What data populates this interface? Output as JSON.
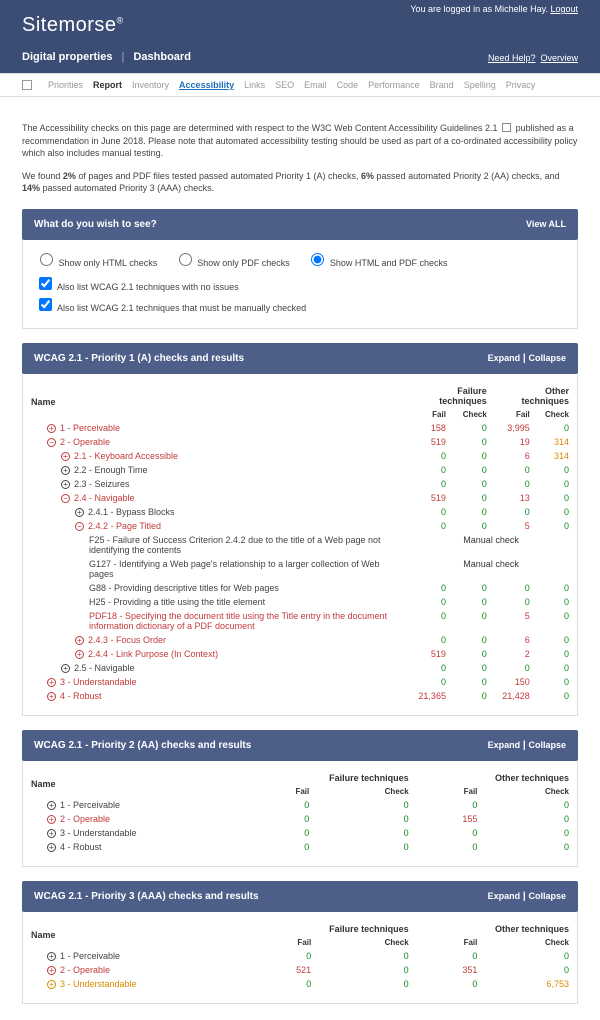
{
  "header": {
    "brand": "Sitemorse",
    "login_prefix": "You are logged in as ",
    "username": "Michelle Hay",
    "logout": "Logout",
    "crumb1": "Digital properties",
    "crumb2": "Dashboard",
    "help": "Need Help?",
    "overview": "Overview"
  },
  "tabs": [
    "Priorities",
    "Report",
    "Inventory",
    "Accessibility",
    "Links",
    "SEO",
    "Email",
    "Code",
    "Performance",
    "Brand",
    "Spelling",
    "Privacy"
  ],
  "intro1a": "The Accessibility checks on this page are determined with respect to the W3C Web Content Accessibility Guidelines 2.1 ",
  "intro1b": " published as a recommendation in June 2018. Please note that automated accessibility testing should be used as part of a co-ordinated accessibility policy which also includes manual testing.",
  "intro2a": "We found ",
  "intro2b": " of pages and PDF files tested passed automated Priority 1 (A) checks, ",
  "intro2c": " passed automated Priority 2 (AA) checks, and ",
  "intro2d": " passed automated Priority 3 (AAA) checks.",
  "pct": {
    "a": "2%",
    "aa": "6%",
    "aaa": "14%"
  },
  "filter": {
    "title": "What do you wish to see?",
    "viewall": "View ALL",
    "opt_html": "Show only HTML checks",
    "opt_pdf": "Show only PDF checks",
    "opt_both": "Show HTML and PDF checks",
    "chk1": "Also list WCAG 2.1 techniques with no issues",
    "chk2": "Also list WCAG 2.1 techniques that must be manually checked"
  },
  "cols": {
    "name": "Name",
    "failgrp": "Failure techniques",
    "othgrp": "Other techniques",
    "fail": "Fail",
    "check": "Check"
  },
  "expand": "Expand",
  "collapse": "Collapse",
  "sections": {
    "a": {
      "title": "WCAG 2.1 - Priority 1 (A) checks and results",
      "rows": [
        {
          "lvl": 0,
          "cls": "red",
          "ico": "+",
          "name": "1 - Perceivable",
          "f": "158",
          "c": "0",
          "of": "3,995",
          "oc": "0"
        },
        {
          "lvl": 0,
          "cls": "red",
          "ico": "−",
          "name": "2 - Operable",
          "f": "519",
          "c": "0",
          "of": "19",
          "oc": "314"
        },
        {
          "lvl": 1,
          "cls": "red",
          "ico": "+",
          "name": "2.1 - Keyboard Accessible",
          "f": "0",
          "c": "0",
          "of": "6",
          "oc": "314"
        },
        {
          "lvl": 1,
          "cls": "",
          "ico": "+",
          "name": "2.2 - Enough Time",
          "f": "0",
          "c": "0",
          "of": "0",
          "oc": "0"
        },
        {
          "lvl": 1,
          "cls": "",
          "ico": "+",
          "name": "2.3 - Seizures",
          "f": "0",
          "c": "0",
          "of": "0",
          "oc": "0"
        },
        {
          "lvl": 1,
          "cls": "red",
          "ico": "−",
          "name": "2.4 - Navigable",
          "f": "519",
          "c": "0",
          "of": "13",
          "oc": "0"
        },
        {
          "lvl": 2,
          "cls": "",
          "ico": "+",
          "name": "2.4.1 - Bypass Blocks",
          "f": "0",
          "c": "0",
          "of": "0",
          "oc": "0"
        },
        {
          "lvl": 2,
          "cls": "red",
          "ico": "−",
          "name": "2.4.2 - Page Titled",
          "f": "0",
          "c": "0",
          "of": "5",
          "oc": "0"
        },
        {
          "lvl": 3,
          "cls": "",
          "ico": "",
          "name": "F25 - Failure of Success Criterion 2.4.2 due to the title of a Web page not identifying the contents",
          "manual": "Manual check"
        },
        {
          "lvl": 3,
          "cls": "",
          "ico": "",
          "name": "G127 - Identifying a Web page's relationship to a larger collection of Web pages",
          "manual": "Manual check"
        },
        {
          "lvl": 3,
          "cls": "",
          "ico": "",
          "name": "G88 - Providing descriptive titles for Web pages",
          "f": "0",
          "c": "0",
          "of": "0",
          "oc": "0"
        },
        {
          "lvl": 3,
          "cls": "",
          "ico": "",
          "name": "H25 - Providing a title using the title element",
          "f": "0",
          "c": "0",
          "of": "0",
          "oc": "0"
        },
        {
          "lvl": 3,
          "cls": "red",
          "ico": "",
          "name": "PDF18 - Specifying the document title using the Title entry in the document information dictionary of a PDF document",
          "f": "0",
          "c": "0",
          "of": "5",
          "oc": "0"
        },
        {
          "lvl": 2,
          "cls": "red",
          "ico": "+",
          "name": "2.4.3 - Focus Order",
          "f": "0",
          "c": "0",
          "of": "6",
          "oc": "0"
        },
        {
          "lvl": 2,
          "cls": "red",
          "ico": "+",
          "name": "2.4.4 - Link Purpose (In Context)",
          "f": "519",
          "c": "0",
          "of": "2",
          "oc": "0"
        },
        {
          "lvl": 1,
          "cls": "",
          "ico": "+",
          "name": "2.5 - Navigable",
          "f": "0",
          "c": "0",
          "of": "0",
          "oc": "0"
        },
        {
          "lvl": 0,
          "cls": "red",
          "ico": "+",
          "name": "3 - Understandable",
          "f": "0",
          "c": "0",
          "of": "150",
          "oc": "0"
        },
        {
          "lvl": 0,
          "cls": "red",
          "ico": "+",
          "name": "4 - Robust",
          "f": "21,365",
          "c": "0",
          "of": "21,428",
          "oc": "0"
        }
      ]
    },
    "aa": {
      "title": "WCAG 2.1 - Priority 2 (AA) checks and results",
      "rows": [
        {
          "lvl": 0,
          "cls": "",
          "ico": "+",
          "name": "1 - Perceivable",
          "f": "0",
          "c": "0",
          "of": "0",
          "oc": "0"
        },
        {
          "lvl": 0,
          "cls": "red",
          "ico": "+",
          "name": "2 - Operable",
          "f": "0",
          "c": "0",
          "of": "155",
          "oc": "0"
        },
        {
          "lvl": 0,
          "cls": "",
          "ico": "+",
          "name": "3 - Understandable",
          "f": "0",
          "c": "0",
          "of": "0",
          "oc": "0"
        },
        {
          "lvl": 0,
          "cls": "",
          "ico": "+",
          "name": "4 - Robust",
          "f": "0",
          "c": "0",
          "of": "0",
          "oc": "0"
        }
      ]
    },
    "aaa": {
      "title": "WCAG 2.1 - Priority 3 (AAA) checks and results",
      "rows": [
        {
          "lvl": 0,
          "cls": "",
          "ico": "+",
          "name": "1 - Perceivable",
          "f": "0",
          "c": "0",
          "of": "0",
          "oc": "0"
        },
        {
          "lvl": 0,
          "cls": "red",
          "ico": "+",
          "name": "2 - Operable",
          "f": "521",
          "c": "0",
          "of": "351",
          "oc": "0"
        },
        {
          "lvl": 0,
          "cls": "orange",
          "ico": "+",
          "name": "3 - Understandable",
          "f": "0",
          "c": "0",
          "of": "0",
          "oc": "6,753"
        }
      ]
    }
  }
}
